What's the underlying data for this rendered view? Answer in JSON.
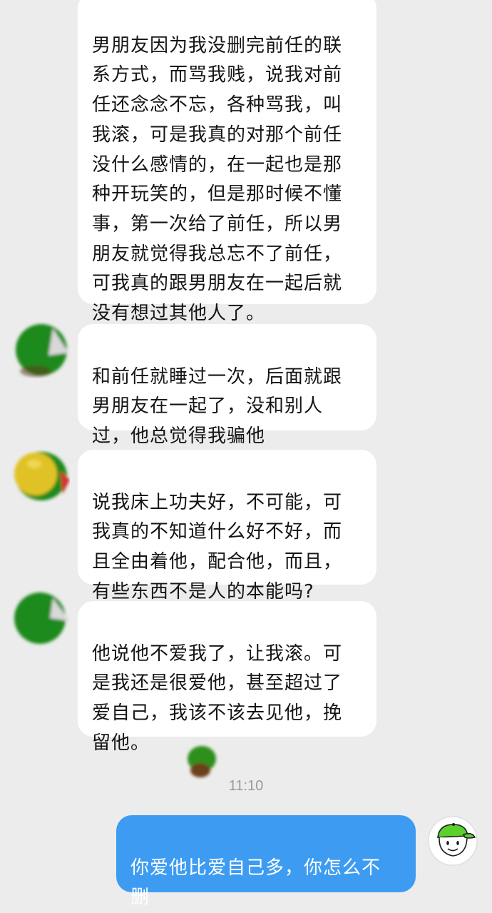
{
  "conversation": {
    "messages": [
      {
        "text": "男朋友因为我没删完前任的联\n系方式，而骂我贱，说我对前\n任还念念不忘，各种骂我，叫\n我滚，可是我真的对那个前任\n没什么感情的，在一起也是那\n种开玩笑的，但是那时候不懂\n事，第一次给了前任，所以男\n朋友就觉得我总忘不了前任，\n可我真的跟男朋友在一起后就\n没有想过其他人了。"
      },
      {
        "text": "和前任就睡过一次，后面就跟\n男朋友在一起了，没和别人\n过，他总觉得我骗他"
      },
      {
        "text": "说我床上功夫好，不可能，可\n我真的不知道什么好不好，而\n且全由着他，配合他，而且，\n有些东西不是人的本能吗?"
      },
      {
        "text": "他说他不爱我了，让我滚。可\n是我还是很爱他，甚至超过了\n爱自己，我该不该去见他，挽\n留他。"
      }
    ],
    "timestamp": "11:10",
    "reply": {
      "text": "你爱他比爱自己多，你怎么不\n删"
    }
  },
  "colors": {
    "background": "#ececec",
    "incoming_bubble": "#ffffff",
    "outgoing_bubble": "#3d9cf2",
    "avatar_green": "#1f8a1a"
  }
}
